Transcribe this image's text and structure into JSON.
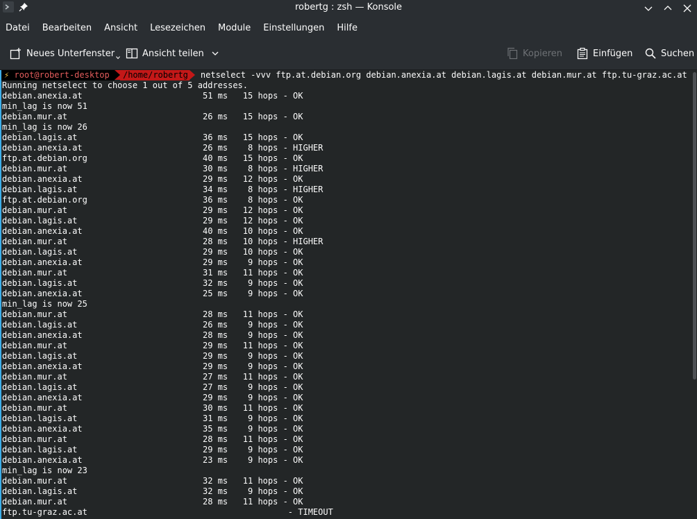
{
  "window": {
    "title": "robertg : zsh — Konsole"
  },
  "menu": [
    "Datei",
    "Bearbeiten",
    "Ansicht",
    "Lesezeichen",
    "Module",
    "Einstellungen",
    "Hilfe"
  ],
  "toolbar": {
    "new_tab": "Neues Unterfenster",
    "split_view": "Ansicht teilen",
    "copy": "Kopieren",
    "paste": "Einfügen",
    "search": "Suchen"
  },
  "prompt": {
    "bolt": "⚡",
    "user": "root@robert-desktop",
    "path": "/home/robertg",
    "command": "netselect -vvv ftp.at.debian.org debian.anexia.at debian.lagis.at debian.mur.at ftp.tu-graz.ac.at"
  },
  "output": [
    "Running netselect to choose 1 out of 5 addresses.",
    "debian.anexia.at                        51 ms   15 hops - OK",
    "min_lag is now 51",
    "debian.mur.at                           26 ms   15 hops - OK",
    "min_lag is now 26",
    "debian.lagis.at                         36 ms   15 hops - OK",
    "debian.anexia.at                        26 ms    8 hops - HIGHER",
    "ftp.at.debian.org                       40 ms   15 hops - OK",
    "debian.mur.at                           30 ms    8 hops - HIGHER",
    "debian.anexia.at                        29 ms   12 hops - OK",
    "debian.lagis.at                         34 ms    8 hops - HIGHER",
    "ftp.at.debian.org                       36 ms    8 hops - OK",
    "debian.mur.at                           29 ms   12 hops - OK",
    "debian.lagis.at                         29 ms   12 hops - OK",
    "debian.anexia.at                        40 ms   10 hops - OK",
    "debian.mur.at                           28 ms   10 hops - HIGHER",
    "debian.lagis.at                         29 ms   10 hops - OK",
    "debian.anexia.at                        29 ms    9 hops - OK",
    "debian.mur.at                           31 ms   11 hops - OK",
    "debian.lagis.at                         32 ms    9 hops - OK",
    "debian.anexia.at                        25 ms    9 hops - OK",
    "min_lag is now 25",
    "debian.mur.at                           28 ms   11 hops - OK",
    "debian.lagis.at                         26 ms    9 hops - OK",
    "debian.anexia.at                        28 ms    9 hops - OK",
    "debian.mur.at                           29 ms   11 hops - OK",
    "debian.lagis.at                         29 ms    9 hops - OK",
    "debian.anexia.at                        29 ms    9 hops - OK",
    "debian.mur.at                           27 ms   11 hops - OK",
    "debian.lagis.at                         27 ms    9 hops - OK",
    "debian.anexia.at                        29 ms    9 hops - OK",
    "debian.mur.at                           30 ms   11 hops - OK",
    "debian.lagis.at                         31 ms    9 hops - OK",
    "debian.anexia.at                        35 ms    9 hops - OK",
    "debian.mur.at                           28 ms   11 hops - OK",
    "debian.lagis.at                         29 ms    9 hops - OK",
    "debian.anexia.at                        23 ms    9 hops - OK",
    "min_lag is now 23",
    "debian.mur.at                           32 ms   11 hops - OK",
    "debian.lagis.at                         32 ms    9 hops - OK",
    "debian.mur.at                           28 ms   11 hops - OK",
    "ftp.tu-graz.ac.at                                        - TIMEOUT"
  ],
  "colors": {
    "background": "#232627",
    "chrome": "#2a2e32",
    "accent": "#3daee9",
    "prompt_red": "#c31818",
    "prompt_user": "#e35c5c"
  }
}
